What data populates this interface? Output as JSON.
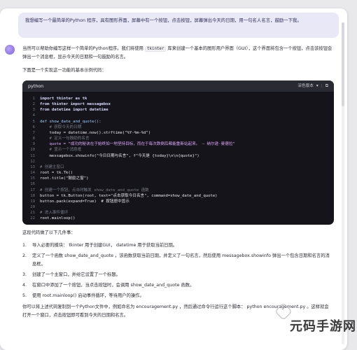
{
  "user_message": "我想编写一个最简单的Python 程序，具有图形界面，屏幕中有一个按钮，点击按钮，屏幕弹出今天的日期，用一句名人名言，鼓励一下我。",
  "answer": {
    "intro_pre": "当然可以帮助你编写这样一个简单的Python程序。我们将使用",
    "intro_code": "tkinter",
    "intro_post": "库来创建一个基本的图形用户界面（GUI），这个界面将包含一个按钮，点击该按钮会弹出一个消息框，显示今天的日期和一句鼓励的名言。",
    "sub": "下面是一个实现这一功能的基本示例代码：",
    "code": {
      "language": "python",
      "copy_label": "深色版本",
      "lines": [
        {
          "n": "1",
          "t": "import tkinter as tk",
          "k": "kw"
        },
        {
          "n": "2",
          "t": "from tkinter import messagebox",
          "k": "kw"
        },
        {
          "n": "3",
          "t": "from datetime import datetime",
          "k": "kw"
        },
        {
          "n": "4",
          "t": "",
          "k": ""
        },
        {
          "n": "5",
          "t": "def show_date_and_quote():",
          "k": "fn"
        },
        {
          "n": "6",
          "t": "    # 获取今天的日期",
          "k": "cm"
        },
        {
          "n": "7",
          "t": "    today = datetime.now().strftime(\"%Y-%m-%d\")",
          "k": ""
        },
        {
          "n": "8",
          "t": "    # 定义一句鼓励的名言",
          "k": "cm"
        },
        {
          "n": "9",
          "t": "    quote = \"成功的秘诀在于始终如一地坚持目标，而在于每次跌倒后都能重新站起来。 — 纳尔逊·曼德拉\"",
          "k": "st"
        },
        {
          "n": "10",
          "t": "    # 显示一个消息框",
          "k": "cm"
        },
        {
          "n": "11",
          "t": "    messagebox.showinfo(\"今日日期与名言\", f\"今天是 {today}\\n\\n{quote}\")",
          "k": ""
        },
        {
          "n": "12",
          "t": "",
          "k": ""
        },
        {
          "n": "13",
          "t": "# 创建主窗口",
          "k": "cm"
        },
        {
          "n": "14",
          "t": "root = tk.Tk()",
          "k": ""
        },
        {
          "n": "15",
          "t": "root.title(\"鼓励之窗\")",
          "k": ""
        },
        {
          "n": "16",
          "t": "",
          "k": ""
        },
        {
          "n": "17",
          "t": "# 创建一个按钮，点击时触发 show_date_and_quote 函数",
          "k": "cm"
        },
        {
          "n": "18",
          "t": "button = tk.Button(root, text=\"点击获取今日名言\", command=show_date_and_quote)",
          "k": ""
        },
        {
          "n": "19",
          "t": "button.pack(expand=True)  # 按钮居中显示",
          "k": ""
        },
        {
          "n": "20",
          "t": "",
          "k": ""
        },
        {
          "n": "21",
          "t": "# 进入事件循环",
          "k": "cm"
        },
        {
          "n": "22",
          "t": "root.mainloop()",
          "k": ""
        }
      ]
    },
    "summary": "这段代码做了以下几件事：",
    "steps": [
      {
        "num": "1.",
        "text": "导入必要的模块： tkinter 用于创建GUI， datetime 用于获取当前日期。"
      },
      {
        "num": "2.",
        "text": "定义了一个函数 show_date_and_quote ，该函数获取当前日期，并定义了一句名言，然后使用 messagebox.showinfo 弹出一个包含日期和名言的消息框。"
      },
      {
        "num": "3.",
        "text": "创建了一个主窗口，并给它设置了一个标题。"
      },
      {
        "num": "4.",
        "text": "在窗口中添加了一个按钮，当点击按钮时，会调用 show_date_and_quote 函数。"
      },
      {
        "num": "5.",
        "text": "使用 root.mainloop() 启动事件循环，等待用户的操作。"
      }
    ],
    "final": "你可以将上述代码复制到一个Python文件中，例如命名为 encouragement.py ，然后通过命令行运行这个脚本： python encouragement.py 。这样就会打开一个窗口，点击按钮即可看到今天的日期和名言。"
  },
  "watermark": "元码手游网"
}
